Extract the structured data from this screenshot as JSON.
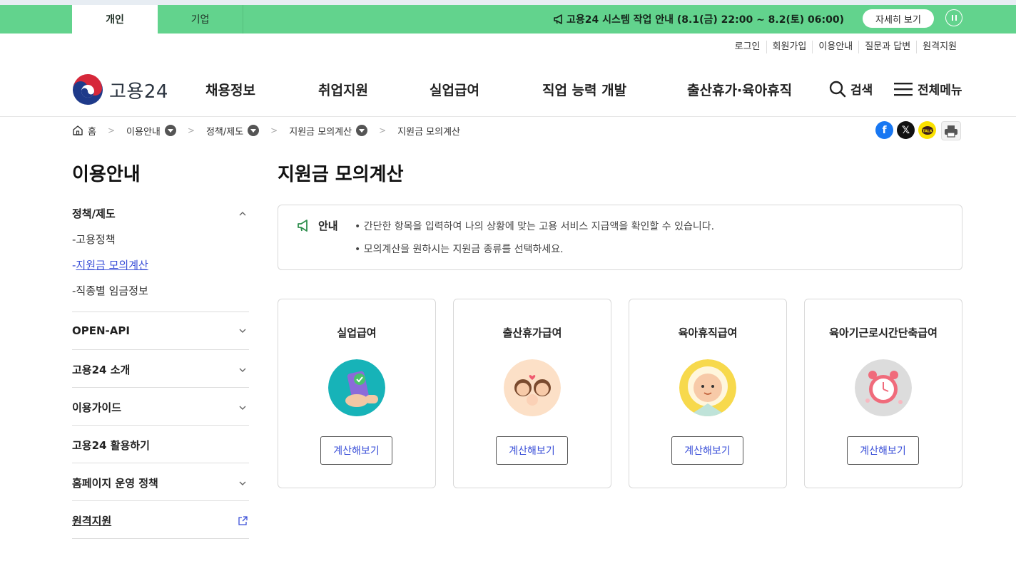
{
  "banner": {
    "tabs": [
      "개인",
      "기업"
    ],
    "notice": "고용24 시스템 작업 안내 (8.1(금) 22:00 ~ 8.2(토) 06:00)",
    "more_label": "자세히 보기",
    "color": "#62d38d"
  },
  "util_links": [
    "로그인",
    "회원가입",
    "이용안내",
    "질문과 답변",
    "원격지원"
  ],
  "logo": {
    "text": "고용24"
  },
  "gnb": [
    "채용정보",
    "취업지원",
    "실업급여",
    "직업 능력 개발",
    "출산휴가·육아휴직"
  ],
  "header_actions": {
    "search": "검색",
    "all_menu": "전체메뉴"
  },
  "breadcrumb": {
    "home": "홈",
    "items": [
      "이용안내",
      "정책/제도",
      "지원금 모의계산",
      "지원금 모의계산"
    ]
  },
  "share_icons": [
    "facebook-icon",
    "x-icon",
    "kakaotalk-icon",
    "print-icon"
  ],
  "sidebar": {
    "title": "이용안내",
    "open_section": "정책/제도",
    "sub_items": [
      "고용정책",
      "지원금 모의계산",
      "직종별 임금정보"
    ],
    "active_sub": "지원금 모의계산",
    "sections": [
      "OPEN-API",
      "고용24 소개",
      "이용가이드",
      "고용24 활용하기",
      "홈페이지 운영 정책",
      "원격지원"
    ]
  },
  "main": {
    "title": "지원금 모의계산",
    "info_label": "안내",
    "info_lines": [
      "간단한 항목을 입력하여 나의 상황에 맞는 고용 서비스 지급액을 확인할 수 있습니다.",
      "모의계산을 원하시는 지원금 종류를 선택하세요."
    ],
    "cards": [
      {
        "title": "실업급여",
        "button": "계산해보기",
        "icon": "phone-check-icon"
      },
      {
        "title": "출산휴가급여",
        "button": "계산해보기",
        "icon": "family-icon"
      },
      {
        "title": "육아휴직급여",
        "button": "계산해보기",
        "icon": "baby-icon"
      },
      {
        "title": "육아기근로시간단축급여",
        "button": "계산해보기",
        "icon": "alarm-clock-icon"
      }
    ]
  },
  "colors": {
    "accent": "#3a4fd8",
    "brand_green": "#62d38d"
  }
}
